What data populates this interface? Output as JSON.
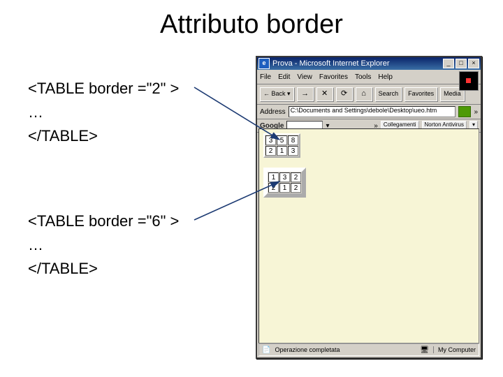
{
  "title": "Attributo border",
  "code1": {
    "open": "<TABLE border =\"2\" >",
    "mid": "…",
    "close": "</TABLE>"
  },
  "code2": {
    "open": "<TABLE border =\"6\" >",
    "mid": "…",
    "close": "</TABLE>"
  },
  "browser": {
    "title": "Prova - Microsoft Internet Explorer",
    "menus": {
      "file": "File",
      "edit": "Edit",
      "view": "View",
      "favorites": "Favorites",
      "tools": "Tools",
      "help": "Help"
    },
    "toolbar": {
      "back": "Back",
      "search": "Search",
      "favorites": "Favorites",
      "media": "Media"
    },
    "address_label": "Address",
    "address_value": "C:\\Documents and Settings\\debole\\Desktop\\ueo.htm",
    "google": {
      "label": "Google",
      "link1": "Collegamenti",
      "link2": "Norton Antivirus"
    },
    "status": {
      "done": "Operazione completata",
      "zone": "My Computer"
    },
    "win": {
      "min": "_",
      "max": "□",
      "close": "×"
    }
  },
  "chart_data": [
    {
      "type": "table",
      "border": 2,
      "rows": [
        [
          3,
          5,
          8
        ],
        [
          2,
          1,
          3
        ]
      ]
    },
    {
      "type": "table",
      "border": 6,
      "rows": [
        [
          1,
          3,
          2
        ],
        [
          2,
          1,
          2
        ]
      ]
    }
  ]
}
